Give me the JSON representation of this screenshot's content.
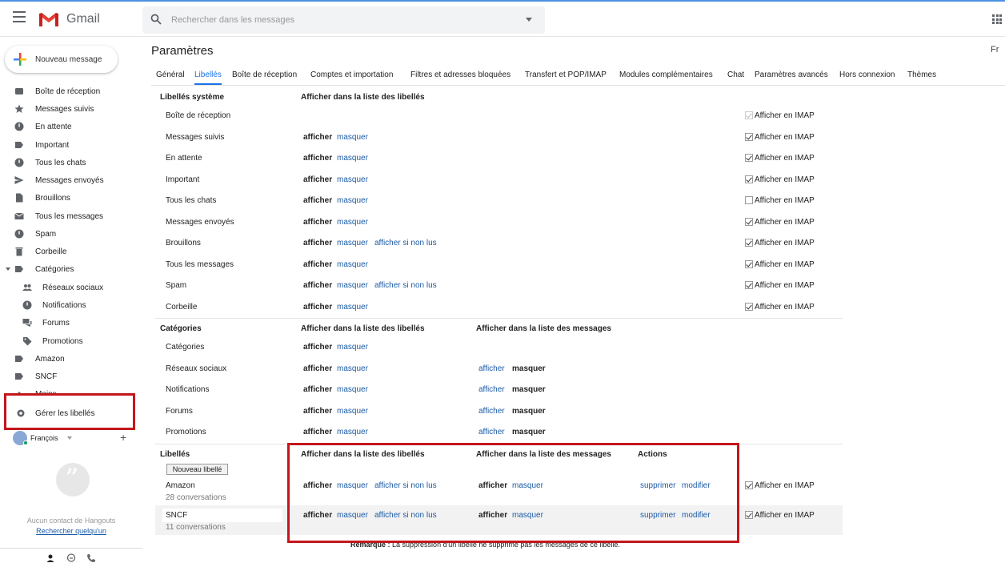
{
  "app": {
    "name": "Gmail"
  },
  "search": {
    "placeholder": "Rechercher dans les messages"
  },
  "compose": {
    "label": "Nouveau message"
  },
  "sidebar": {
    "items": [
      {
        "label": "Boîte de réception",
        "icon": "inbox-icon"
      },
      {
        "label": "Messages suivis",
        "icon": "star-icon"
      },
      {
        "label": "En attente",
        "icon": "clock-icon"
      },
      {
        "label": "Important",
        "icon": "important-icon"
      },
      {
        "label": "Tous les chats",
        "icon": "chat-icon"
      },
      {
        "label": "Messages envoyés",
        "icon": "send-icon"
      },
      {
        "label": "Brouillons",
        "icon": "draft-icon"
      },
      {
        "label": "Tous les messages",
        "icon": "mail-icon"
      },
      {
        "label": "Spam",
        "icon": "spam-icon"
      },
      {
        "label": "Corbeille",
        "icon": "trash-icon"
      },
      {
        "label": "Catégories",
        "icon": "label-icon"
      },
      {
        "label": "Réseaux sociaux",
        "icon": "people-icon"
      },
      {
        "label": "Notifications",
        "icon": "info-icon"
      },
      {
        "label": "Forums",
        "icon": "forum-icon"
      },
      {
        "label": "Promotions",
        "icon": "tag-icon"
      },
      {
        "label": "Amazon",
        "icon": "label-icon"
      },
      {
        "label": "SNCF",
        "icon": "label-icon"
      },
      {
        "label": "Moins",
        "icon": "chevron-up-icon"
      }
    ],
    "manage_labels": "Gérer les libellés",
    "user": "François",
    "hangouts_empty": "Aucun contact de Hangouts",
    "hangouts_link": "Rechercher quelqu'un"
  },
  "page": {
    "title": "Paramètres",
    "lang": "Fr"
  },
  "tabs": [
    "Général",
    "Libellés",
    "Boîte de réception",
    "Comptes et importation",
    "Filtres et adresses bloquées",
    "Transfert et POP/IMAP",
    "Modules complémentaires",
    "Chat",
    "Paramètres avancés",
    "Hors connexion",
    "Thèmes"
  ],
  "system": {
    "header": "Libellés système",
    "col_header": "Afficher dans la liste des libellés",
    "rows": [
      {
        "name": "Boîte de réception",
        "imap": "Afficher en IMAP"
      },
      {
        "name": "Messages suivis",
        "show": "afficher",
        "hide": "masquer",
        "imap": "Afficher en IMAP"
      },
      {
        "name": "En attente",
        "show": "afficher",
        "hide": "masquer",
        "imap": "Afficher en IMAP"
      },
      {
        "name": "Important",
        "show": "afficher",
        "hide": "masquer",
        "imap": "Afficher en IMAP"
      },
      {
        "name": "Tous les chats",
        "show": "afficher",
        "hide": "masquer",
        "imap": "Afficher en IMAP"
      },
      {
        "name": "Messages envoyés",
        "show": "afficher",
        "hide": "masquer",
        "imap": "Afficher en IMAP"
      },
      {
        "name": "Brouillons",
        "show": "afficher",
        "hide": "masquer",
        "unread": "afficher si non lus",
        "imap": "Afficher en IMAP"
      },
      {
        "name": "Tous les messages",
        "show": "afficher",
        "hide": "masquer",
        "imap": "Afficher en IMAP"
      },
      {
        "name": "Spam",
        "show": "afficher",
        "hide": "masquer",
        "unread": "afficher si non lus",
        "imap": "Afficher en IMAP"
      },
      {
        "name": "Corbeille",
        "show": "afficher",
        "hide": "masquer",
        "imap": "Afficher en IMAP"
      }
    ]
  },
  "categories": {
    "header": "Catégories",
    "col1": "Afficher dans la liste des libellés",
    "col2": "Afficher dans la liste des messages",
    "rows": [
      {
        "name": "Catégories",
        "show": "afficher",
        "hide": "masquer"
      },
      {
        "name": "Réseaux sociaux",
        "show": "afficher",
        "hide": "masquer",
        "mshow": "afficher",
        "mhide": "masquer"
      },
      {
        "name": "Notifications",
        "show": "afficher",
        "hide": "masquer",
        "mshow": "afficher",
        "mhide": "masquer"
      },
      {
        "name": "Forums",
        "show": "afficher",
        "hide": "masquer",
        "mshow": "afficher",
        "mhide": "masquer"
      },
      {
        "name": "Promotions",
        "show": "afficher",
        "hide": "masquer",
        "mshow": "afficher",
        "mhide": "masquer"
      }
    ]
  },
  "labels": {
    "header": "Libellés",
    "new_button": "Nouveau libellé",
    "col1": "Afficher dans la liste des libellés",
    "col2": "Afficher dans la liste des messages",
    "col3": "Actions",
    "rows": [
      {
        "name": "Amazon",
        "count": "28 conversations",
        "show": "afficher",
        "hide": "masquer",
        "unread": "afficher si non lus",
        "mshow": "afficher",
        "mhide": "masquer",
        "delete": "supprimer",
        "edit": "modifier",
        "imap": "Afficher en IMAP"
      },
      {
        "name": "SNCF",
        "count": "11 conversations",
        "show": "afficher",
        "hide": "masquer",
        "unread": "afficher si non lus",
        "mshow": "afficher",
        "mhide": "masquer",
        "delete": "supprimer",
        "edit": "modifier",
        "imap": "Afficher en IMAP"
      }
    ]
  },
  "note": {
    "label": "Remarque :",
    "text": "La suppression d'un libellé ne supprime pas les messages de ce libellé."
  }
}
